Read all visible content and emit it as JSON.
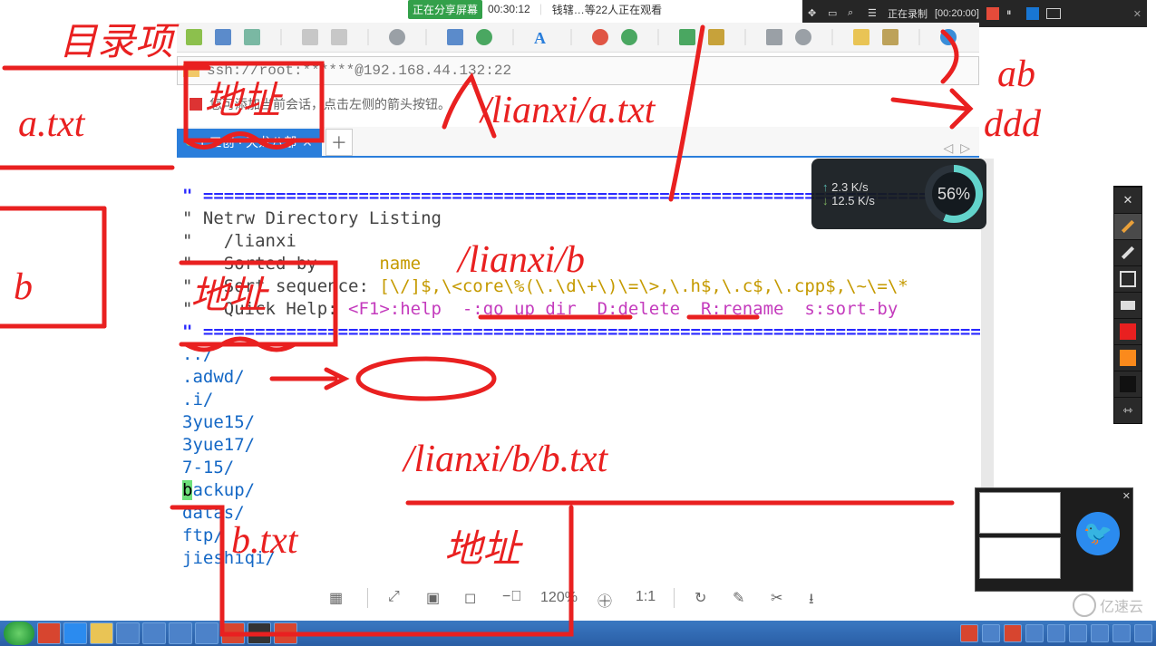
{
  "share": {
    "label": "正在分享屏幕",
    "timer": "00:30:12",
    "viewers": "钱辖…等22人正在观看"
  },
  "recording": {
    "label": "正在录制",
    "timer": "[00:20:00]"
  },
  "address": "ssh://root:******@192.168.44.132:22",
  "hint": "您可添加当前会话，点击左侧的箭头按钮。",
  "tab": {
    "title": "1 三创 · 天龙八部",
    "close": "✕",
    "plus": "＋",
    "prev": "◁",
    "next": "▷"
  },
  "netrw": {
    "bar": "\" ============================================================================",
    "title": "\" Netrw Directory Listing",
    "cwd": "\"   /lianxi",
    "sortedP": "\"   Sorted by      ",
    "sorted": "name",
    "seqP": "\"   Sort sequence: ",
    "seq": "[\\/]$,\\<core\\%(\\.\\d\\+\\)\\=\\>,\\.h$,\\.c$,\\.cpp$,\\~\\=\\*",
    "helpP": "\"   Quick Help: ",
    "help": "<F1>:help  -:go up dir  D:delete  R:rename  s:sort-by",
    "list": [
      "../",
      ".adwd/",
      ".i/",
      "3yue15/",
      "3yue17/",
      "7-15/",
      "backup/",
      "datas/",
      "ftp/",
      "jieshiqi/"
    ]
  },
  "gauge": {
    "up": "2.3 K/s",
    "down": "12.5 K/s",
    "pct": "56%"
  },
  "bottombar": {
    "zoom": "120%"
  },
  "tool_colors": [
    "#e92020",
    "#fb8a1c",
    "#111111"
  ],
  "watermark": "亿速云",
  "annotations": {
    "a1": "目录项",
    "a2": "a.txt",
    "a3": "b",
    "s1": "地址",
    "s2": "地址",
    "s3": "地址",
    "p1": "/lianxi/a.txt",
    "p2": "/lianxi/b",
    "p3": "/lianxi/b/b.txt",
    "r1": "ab",
    "r2": "ddd",
    "f1": "b.txt"
  }
}
